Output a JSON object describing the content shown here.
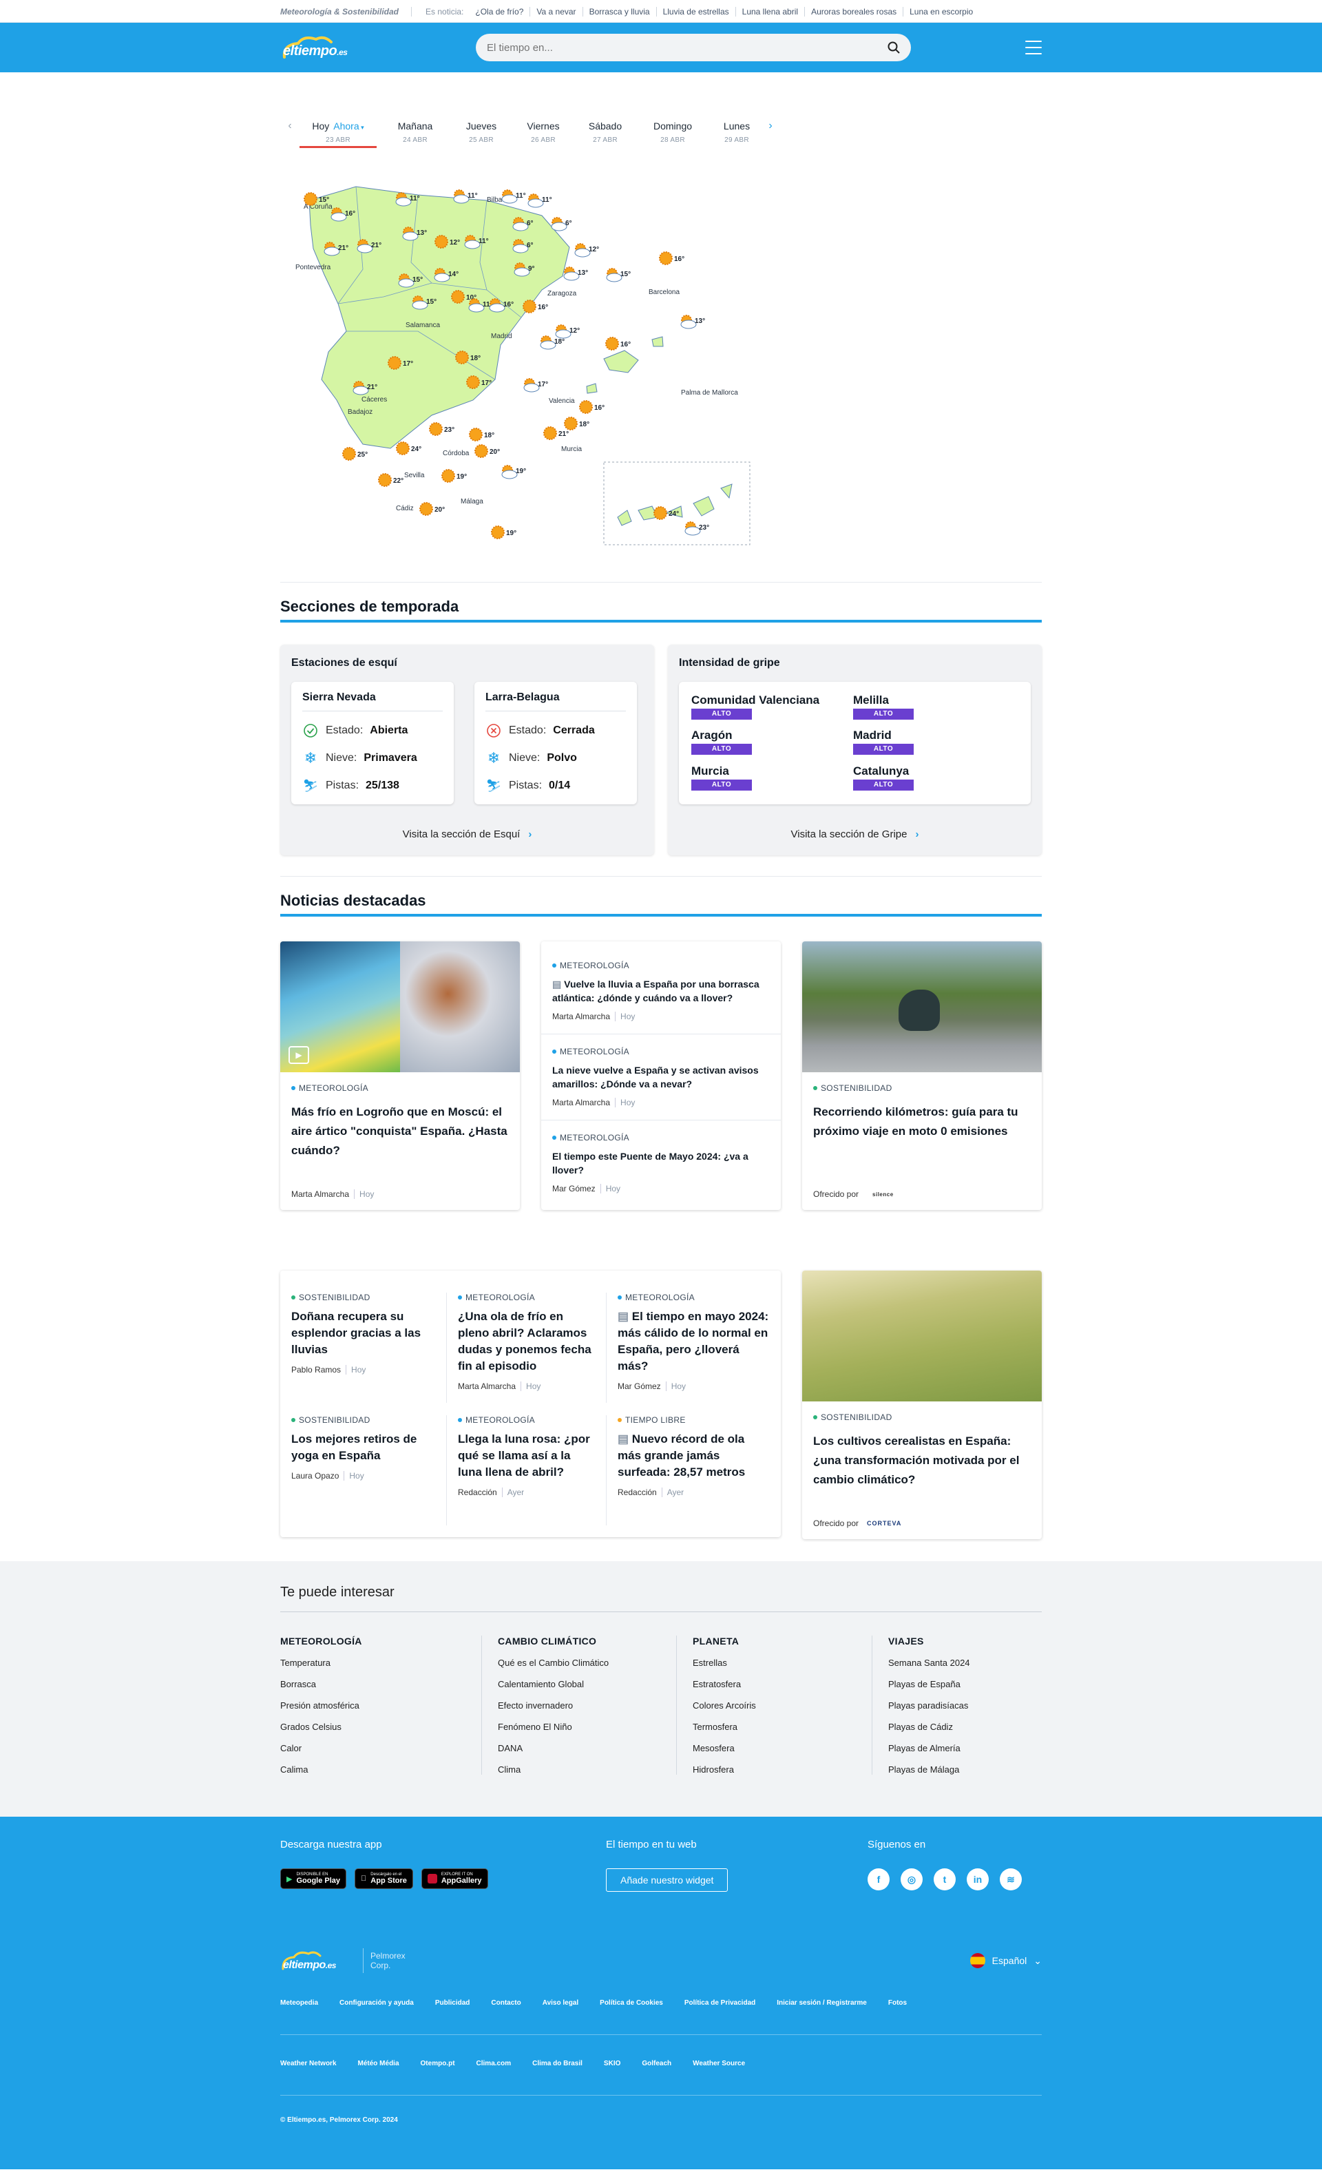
{
  "topbar": {
    "brand": "Meteorología & Sostenibilidad",
    "news_label": "Es noticia:",
    "links": [
      "¿Ola de frío?",
      "Va a nevar",
      "Borrasca y lluvia",
      "Lluvia de estrellas",
      "Luna llena abril",
      "Auroras boreales rosas",
      "Luna en escorpio"
    ]
  },
  "header": {
    "logo": "eltiempo",
    "logo_suffix": ".es",
    "search_placeholder": "El tiempo en..."
  },
  "days": [
    {
      "name": "Hoy",
      "extra": "Ahora",
      "date": "23 ABR"
    },
    {
      "name": "Mañana",
      "date": "24 ABR"
    },
    {
      "name": "Jueves",
      "date": "25 ABR"
    },
    {
      "name": "Viernes",
      "date": "26 ABR"
    },
    {
      "name": "Sábado",
      "date": "27 ABR"
    },
    {
      "name": "Domingo",
      "date": "28 ABR"
    },
    {
      "name": "Lunes",
      "date": "29 ABR"
    }
  ],
  "map": {
    "cities": [
      "A Coruña",
      "Bilbao",
      "Pontevedra",
      "Zaragoza",
      "Barcelona",
      "Salamanca",
      "Madrid",
      "Palma de Mallorca",
      "Cáceres",
      "Valencia",
      "Badajoz",
      "Córdoba",
      "Murcia",
      "Sevilla",
      "Málaga",
      "Cádiz"
    ],
    "temps": [
      "15°",
      "11°",
      "11°",
      "11°",
      "11°",
      "16°",
      "6°",
      "6°",
      "13°",
      "21°",
      "21°",
      "12°",
      "11°",
      "6°",
      "12°",
      "16°",
      "15°",
      "14°",
      "9°",
      "13°",
      "15°",
      "15°",
      "10°",
      "11°",
      "16°",
      "16°",
      "12°",
      "13°",
      "18°",
      "16°",
      "17°",
      "18°",
      "17°",
      "17°",
      "21°",
      "16°",
      "18°",
      "23°",
      "18°",
      "21°",
      "25°",
      "24°",
      "20°",
      "19°",
      "19°",
      "22°",
      "20°",
      "24°",
      "23°",
      "19°"
    ]
  },
  "season": {
    "title": "Secciones de temporada",
    "ski": {
      "title": "Estaciones de esquí",
      "stations": [
        {
          "name": "Sierra Nevada",
          "status_label": "Estado:",
          "status": "Abierta",
          "snow_label": "Nieve:",
          "snow": "Primavera",
          "pistes_label": "Pistas:",
          "pistes": "25/138"
        },
        {
          "name": "Larra-Belagua",
          "status_label": "Estado:",
          "status": "Cerrada",
          "snow_label": "Nieve:",
          "snow": "Polvo",
          "pistes_label": "Pistas:",
          "pistes": "0/14"
        }
      ],
      "visit": "Visita la sección de Esquí"
    },
    "flu": {
      "title": "Intensidad de gripe",
      "regions": [
        {
          "name": "Comunidad Valenciana",
          "level": "ALTO"
        },
        {
          "name": "Melilla",
          "level": "ALTO"
        },
        {
          "name": "Aragón",
          "level": "ALTO"
        },
        {
          "name": "Madrid",
          "level": "ALTO"
        },
        {
          "name": "Murcia",
          "level": "ALTO"
        },
        {
          "name": "Catalunya",
          "level": "ALTO"
        }
      ],
      "visit": "Visita la sección de Gripe",
      "level_color": "#6a3fd0"
    }
  },
  "news": {
    "title": "Noticias destacadas",
    "featured": {
      "tag": "METEOROLOGÍA",
      "title": "Más frío en Logroño que en Moscú: el aire ártico \"conquista\" España. ¿Hasta cuándo?",
      "author": "Marta Almarcha",
      "time": "Hoy"
    },
    "list": [
      {
        "tag": "METEOROLOGÍA",
        "title": "Vuelve la lluvia a España por una borrasca atlántica: ¿dónde y cuándo va a llover?",
        "author": "Marta Almarcha",
        "time": "Hoy"
      },
      {
        "tag": "METEOROLOGÍA",
        "title": "La nieve vuelve a España y se activan avisos amarillos: ¿Dónde va a nevar?",
        "author": "Marta Almarcha",
        "time": "Hoy"
      },
      {
        "tag": "METEOROLOGÍA",
        "title": "El tiempo este Puente de Mayo 2024: ¿va a llover?",
        "author": "Mar Gómez",
        "time": "Hoy"
      }
    ],
    "sponsored1": {
      "tag": "SOSTENIBILIDAD",
      "title": "Recorriendo kilómetros: guía para tu próximo viaje en moto 0 emisiones",
      "offered": "Ofrecido por",
      "sponsor": "silence"
    },
    "grid": [
      {
        "tag": "SOSTENIBILIDAD",
        "title": "Doñana recupera su esplendor gracias a las lluvias",
        "author": "Pablo Ramos",
        "time": "Hoy"
      },
      {
        "tag": "METEOROLOGÍA",
        "title": "¿Una ola de frío en pleno abril? Aclaramos dudas y ponemos fecha fin al episodio",
        "author": "Marta Almarcha",
        "time": "Hoy"
      },
      {
        "tag": "METEOROLOGÍA",
        "title": "El tiempo en mayo 2024: más cálido de lo normal en España, pero ¿lloverá más?",
        "author": "Mar Gómez",
        "time": "Hoy"
      },
      {
        "tag": "SOSTENIBILIDAD",
        "title": "Los mejores retiros de yoga en España",
        "author": "Laura Opazo",
        "time": "Hoy"
      },
      {
        "tag": "METEOROLOGÍA",
        "title": "Llega la luna rosa: ¿por qué se llama así a la luna llena de abril?",
        "author": "Redacción",
        "time": "Ayer"
      },
      {
        "tag": "TIEMPO LIBRE",
        "title": "Nuevo récord de ola más grande jamás surfeada: 28,57 metros",
        "author": "Redacción",
        "time": "Ayer"
      }
    ],
    "sponsored2": {
      "tag": "SOSTENIBILIDAD",
      "title": "Los cultivos cerealistas en España: ¿una transformación motivada por el cambio climático?",
      "offered": "Ofrecido por",
      "sponsor": "CORTEVA"
    }
  },
  "interest": {
    "title": "Te puede interesar",
    "columns": [
      {
        "title": "METEOROLOGÍA",
        "links": [
          "Temperatura",
          "Borrasca",
          "Presión atmosférica",
          "Grados Celsius",
          "Calor",
          "Calima"
        ]
      },
      {
        "title": "CAMBIO CLIMÁTICO",
        "links": [
          "Qué es el Cambio Climático",
          "Calentamiento Global",
          "Efecto invernadero",
          "Fenómeno El Niño",
          "DANA",
          "Clima"
        ]
      },
      {
        "title": "PLANETA",
        "links": [
          "Estrellas",
          "Estratosfera",
          "Colores Arcoíris",
          "Termosfera",
          "Mesosfera",
          "Hidrosfera"
        ]
      },
      {
        "title": "VIAJES",
        "links": [
          "Semana Santa 2024",
          "Playas de España",
          "Playas paradisíacas",
          "Playas de Cádiz",
          "Playas de Almería",
          "Playas de Málaga"
        ]
      }
    ]
  },
  "footer": {
    "app_title": "Descarga nuestra app",
    "stores": [
      {
        "small": "DISPONIBLE EN",
        "name": "Google Play"
      },
      {
        "small": "Descárgalo en el",
        "name": "App Store"
      },
      {
        "small": "EXPLORE IT ON",
        "name": "AppGallery"
      }
    ],
    "web_title": "El tiempo en tu web",
    "widget_btn": "Añade nuestro widget",
    "follow_title": "Síguenos en",
    "corp": "Pelmorex Corp.",
    "language": "Español",
    "links1": [
      "Meteopedia",
      "Configuración y ayuda",
      "Publicidad",
      "Contacto",
      "Aviso legal",
      "Política de Cookies",
      "Política de Privacidad",
      "Iniciar sesión / Registrarme",
      "Fotos"
    ],
    "links2": [
      "Weather Network",
      "Météo Média",
      "Otempo.pt",
      "Clima.com",
      "Clima do Brasil",
      "SKIO",
      "Golfeach",
      "Weather Source"
    ],
    "copyright": "© Eltiempo.es, Pelmorex Corp. 2024"
  },
  "colors": {
    "brand": "#1fa1e6",
    "active_day": "#e5483f",
    "map_land": "#d5f5a4"
  }
}
